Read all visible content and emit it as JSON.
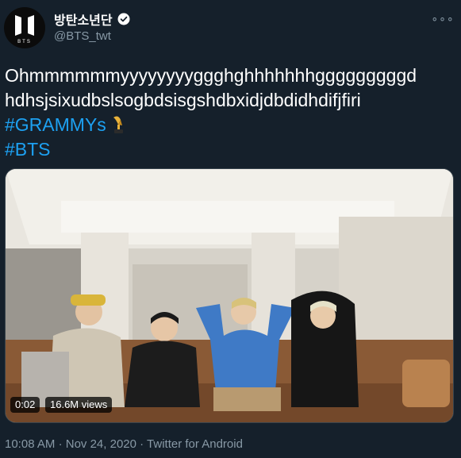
{
  "author": {
    "display_name": "방탄소년단",
    "handle": "@BTS_twt",
    "avatar_text": "BTS"
  },
  "more_label": "∘∘∘",
  "tweet": {
    "line1": "Ohmmmmmmyyyyyyyyggghghhhhhhhgggggggggd",
    "line2": "hdhsjsixudbslsogbdsisgshdbxidjdbdidhdifjfiri",
    "hashtag1": "#GRAMMYs",
    "hashtag2": "#BTS"
  },
  "video": {
    "time": "0:02",
    "views": "16.6M views"
  },
  "meta": {
    "time": "10:08 AM",
    "separator": "·",
    "date": "Nov 24, 2020",
    "source": "Twitter for Android"
  },
  "colors": {
    "background": "#15202b",
    "secondary_text": "#8899a6",
    "link": "#1da1f2"
  },
  "icons": [
    "verified-badge-icon",
    "more-icon",
    "grammy-trophy-icon"
  ]
}
